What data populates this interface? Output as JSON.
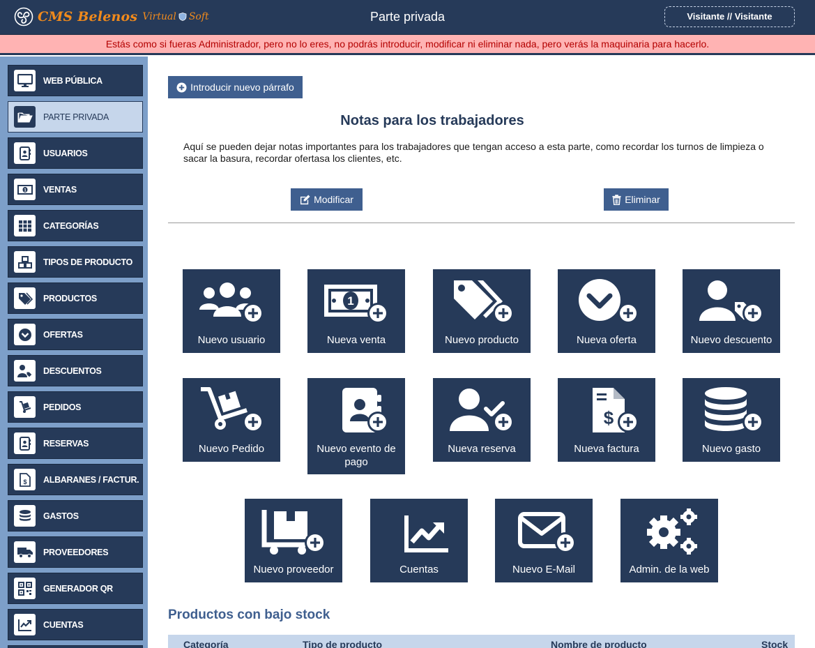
{
  "header": {
    "logo_text": "CMS Belenos",
    "logo_virtual": "Virtual",
    "logo_soft": "Soft",
    "title": "Parte privada",
    "user": "Visitante // Visitante"
  },
  "warning": "Estás como si fueras Administrador, pero no lo eres, no podrás introducir, modificar ni eliminar nada, pero verás la maquinaria para hacerlo.",
  "sidebar": {
    "items": [
      {
        "label": "WEB PÚBLICA",
        "icon": "monitor-icon"
      },
      {
        "label": "PARTE PRIVADA",
        "icon": "folder-open-icon",
        "active": true
      },
      {
        "label": "USUARIOS",
        "icon": "address-book-icon"
      },
      {
        "label": "VENTAS",
        "icon": "money-bill-icon"
      },
      {
        "label": "CATEGORÍAS",
        "icon": "grid-icon"
      },
      {
        "label": "TIPOS DE PRODUCTO",
        "icon": "cubes-icon"
      },
      {
        "label": "PRODUCTOS",
        "icon": "tags-icon"
      },
      {
        "label": "OFERTAS",
        "icon": "chevron-circle-icon"
      },
      {
        "label": "DESCUENTOS",
        "icon": "user-tag-icon"
      },
      {
        "label": "PEDIDOS",
        "icon": "dolly-icon"
      },
      {
        "label": "RESERVAS",
        "icon": "address-book-icon"
      },
      {
        "label": "ALBARANES / FACTUR.",
        "icon": "invoice-icon"
      },
      {
        "label": "GASTOS",
        "icon": "coins-icon"
      },
      {
        "label": "PROVEEDORES",
        "icon": "truck-icon"
      },
      {
        "label": "GENERADOR QR",
        "icon": "qrcode-icon"
      },
      {
        "label": "CUENTAS",
        "icon": "chart-line-icon"
      }
    ]
  },
  "main": {
    "new_paragraph_label": "Introducir nuevo párrafo",
    "notes_title": "Notas para los trabajadores",
    "notes_text": "Aquí se pueden dejar notas importantes para los trabajadores que tengan acceso a esta parte, como recordar los turnos de limpieza o sacar la basura, recordar ofertasa los clientes, etc.",
    "modify_label": "Modificar",
    "delete_label": "Eliminar",
    "tiles": [
      {
        "label": "Nuevo usuario",
        "icon": "users-plus-icon"
      },
      {
        "label": "Nueva venta",
        "icon": "money-plus-icon"
      },
      {
        "label": "Nuevo producto",
        "icon": "tags-plus-icon"
      },
      {
        "label": "Nueva oferta",
        "icon": "chevron-plus-icon"
      },
      {
        "label": "Nuevo descuento",
        "icon": "user-tag-plus-icon"
      },
      {
        "label": "Nuevo Pedido",
        "icon": "dolly-plus-icon"
      },
      {
        "label": "Nuevo evento de pago",
        "icon": "address-book-plus-icon"
      },
      {
        "label": "Nueva reserva",
        "icon": "user-check-plus-icon"
      },
      {
        "label": "Nueva factura",
        "icon": "invoice-plus-icon"
      },
      {
        "label": "Nuevo gasto",
        "icon": "coins-plus-icon"
      },
      {
        "label": "Nuevo proveedor",
        "icon": "pallet-plus-icon"
      },
      {
        "label": "Cuentas",
        "icon": "chart-line-icon"
      },
      {
        "label": "Nuevo E-Mail",
        "icon": "envelope-plus-icon"
      },
      {
        "label": "Admin. de la web",
        "icon": "cogs-icon"
      }
    ],
    "low_stock_title": "Productos con bajo stock",
    "low_stock_columns": [
      "Categoría",
      "Tipo de producto",
      "Nombre de producto",
      "Stock"
    ]
  },
  "colors": {
    "navy": "#263a59",
    "button": "#3f5f8f",
    "sidebar_bg": "#7d9fc9",
    "warning_bg": "#ffb3b3",
    "warning_text": "#b30000",
    "logo_orange": "#f08a1c"
  }
}
